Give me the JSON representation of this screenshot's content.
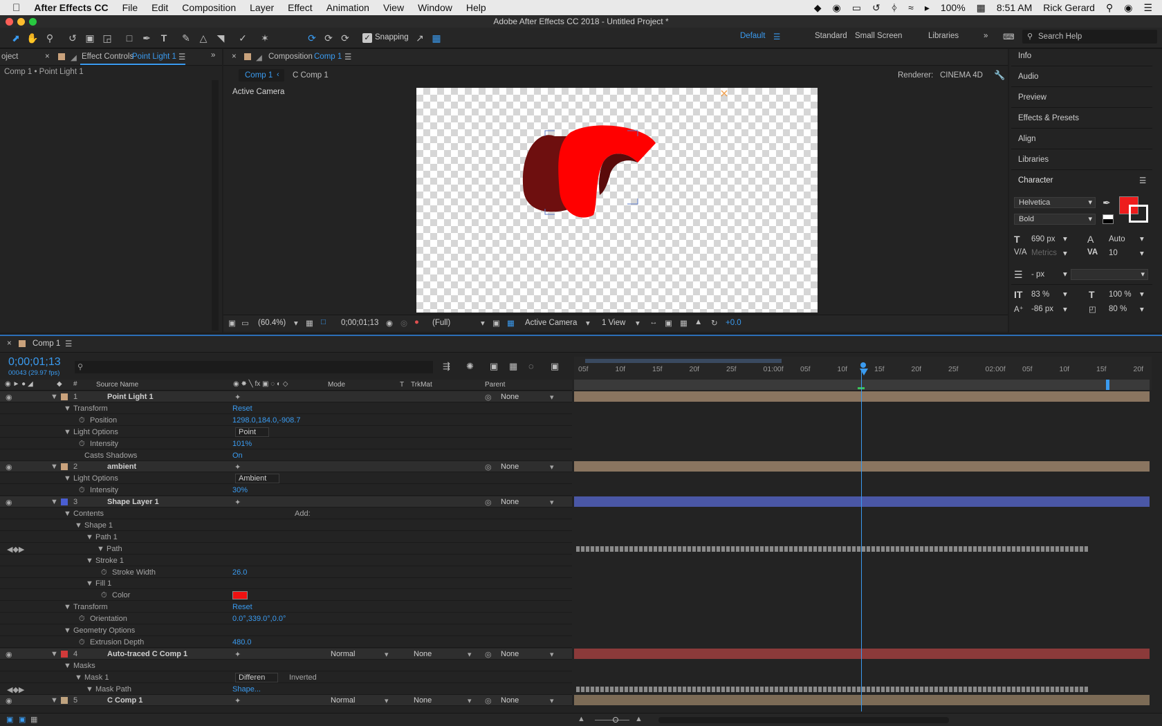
{
  "menubar": {
    "app": "After Effects CC",
    "items": [
      "File",
      "Edit",
      "Composition",
      "Layer",
      "Effect",
      "Animation",
      "View",
      "Window",
      "Help"
    ],
    "battery": "100%",
    "clock": "8:51 AM",
    "user": "Rick Gerard"
  },
  "window": {
    "title": "Adobe After Effects CC 2018 - Untitled Project *"
  },
  "toolbar": {
    "snapping_label": "Snapping",
    "workspaces": [
      "Default",
      "Standard",
      "Small Screen",
      "Libraries"
    ],
    "search_placeholder": "Search Help"
  },
  "effect_controls": {
    "tab_left": "oject",
    "tab_label": "Effect Controls",
    "tab_layer": "Point Light 1",
    "breadcrumb": "Comp 1 • Point Light 1"
  },
  "composition": {
    "tab_label": "Composition",
    "tab_comp": "Comp 1",
    "nav_active": "Comp 1",
    "nav_other": "C Comp 1",
    "renderer_label": "Renderer:",
    "renderer_value": "CINEMA 4D",
    "active_camera": "Active Camera",
    "zoom": "(60.4%)",
    "timecode": "0;00;01;13",
    "resolution": "(Full)",
    "camera_select": "Active Camera",
    "view_select": "1 View",
    "exposure": "+0.0"
  },
  "right_panel": {
    "items": [
      "Info",
      "Audio",
      "Preview",
      "Effects & Presets",
      "Align",
      "Libraries",
      "Character"
    ],
    "font": "Helvetica",
    "style": "Bold",
    "size": "690 px",
    "leading": "Auto",
    "kerning": "Metrics",
    "tracking": "10",
    "stroke_width": "- px",
    "vscale": "83 %",
    "hscale": "100 %",
    "baseline": "-86 px",
    "tsume": "80 %",
    "fill_color": "#ee1c1c"
  },
  "timeline": {
    "tab": "Comp 1",
    "timecode": "0;00;01;13",
    "frames": "00043 (29.97 fps)",
    "columns": {
      "source": "Source Name",
      "mode": "Mode",
      "t": "T",
      "trkmat": "TrkMat",
      "parent": "Parent"
    },
    "ruler": [
      "05f",
      "10f",
      "15f",
      "20f",
      "25f",
      "01:00f",
      "05f",
      "10f",
      "15f",
      "20f",
      "25f",
      "02:00f",
      "05f",
      "10f",
      "15f",
      "20f"
    ],
    "rows": [
      {
        "indent": 0,
        "num": "1",
        "name": "Point Light 1",
        "parent": "None",
        "label": "#c9a27c",
        "color": "#8a7560",
        "layer": true
      },
      {
        "indent": 1,
        "name": "Transform",
        "value": "Reset"
      },
      {
        "indent": 2,
        "name": "Position",
        "value": "1298.0,184.0,-908.7",
        "stopwatch": true
      },
      {
        "indent": 1,
        "name": "Light Options",
        "select": "Point"
      },
      {
        "indent": 2,
        "name": "Intensity",
        "value": "101%",
        "stopwatch": true
      },
      {
        "indent": 2,
        "name": "Casts Shadows",
        "value": "On"
      },
      {
        "indent": 0,
        "num": "2",
        "name": "ambient",
        "parent": "None",
        "label": "#c9a27c",
        "color": "#8a7560",
        "layer": true
      },
      {
        "indent": 1,
        "name": "Light Options",
        "select": "Ambient"
      },
      {
        "indent": 2,
        "name": "Intensity",
        "value": "30%",
        "stopwatch": true
      },
      {
        "indent": 0,
        "num": "3",
        "name": "Shape Layer 1",
        "parent": "None",
        "label": "#4a5ed2",
        "color": "#4a57a6",
        "layer": true
      },
      {
        "indent": 1,
        "name": "Contents",
        "add": "Add:"
      },
      {
        "indent": 2,
        "name": "Shape 1"
      },
      {
        "indent": 3,
        "name": "Path 1"
      },
      {
        "indent": 4,
        "name": "Path",
        "keys": true
      },
      {
        "indent": 3,
        "name": "Stroke 1"
      },
      {
        "indent": 4,
        "name": "Stroke Width",
        "value": "26.0",
        "stopwatch": true
      },
      {
        "indent": 3,
        "name": "Fill 1"
      },
      {
        "indent": 4,
        "name": "Color",
        "swatch": true,
        "stopwatch": true
      },
      {
        "indent": 1,
        "name": "Transform",
        "value": "Reset"
      },
      {
        "indent": 2,
        "name": "Orientation",
        "value": "0.0°,339.0°,0.0°",
        "stopwatch": true
      },
      {
        "indent": 1,
        "name": "Geometry Options"
      },
      {
        "indent": 2,
        "name": "Extrusion Depth",
        "value": "480.0",
        "stopwatch": true
      },
      {
        "indent": 0,
        "num": "4",
        "name": "Auto-traced C Comp 1",
        "mode": "Normal",
        "trkmat": "None",
        "parent": "None",
        "label": "#d13a3a",
        "color": "#8b3a3a",
        "layer": true
      },
      {
        "indent": 1,
        "name": "Masks"
      },
      {
        "indent": 2,
        "name": "Mask 1",
        "select": "Differen",
        "inverted": "Inverted"
      },
      {
        "indent": 3,
        "name": "Mask Path",
        "value": "Shape...",
        "keys": true
      },
      {
        "indent": 0,
        "num": "5",
        "name": "C Comp 1",
        "mode": "Normal",
        "trkmat": "None",
        "parent": "None",
        "label": "#bfa37f",
        "color": "#7c6b56",
        "layer": true
      }
    ]
  }
}
